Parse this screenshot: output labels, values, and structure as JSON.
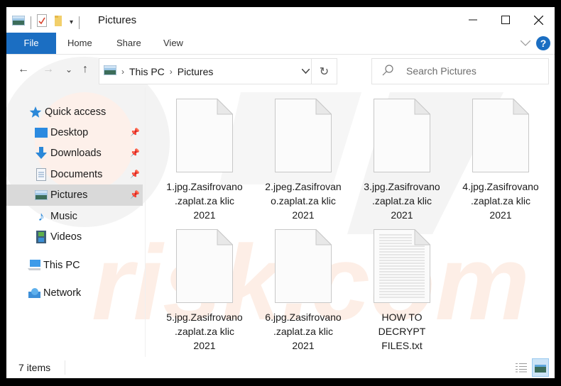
{
  "window": {
    "title": "Pictures",
    "controls": {
      "minimize": "minimize",
      "maximize": "maximize",
      "close": "close"
    }
  },
  "quick_access_toolbar": {
    "icons": [
      "pictures-folder-icon",
      "properties-icon",
      "new-folder-icon",
      "customize-dropdown-icon"
    ]
  },
  "ribbon": {
    "tabs": [
      {
        "label": "File",
        "active": true
      },
      {
        "label": "Home"
      },
      {
        "label": "Share"
      },
      {
        "label": "View"
      }
    ],
    "help_label": "?",
    "accent": "#1b6ec2"
  },
  "navigation": {
    "back": "←",
    "forward": "→",
    "recent": "⌄",
    "up": "↑",
    "breadcrumb": [
      "This PC",
      "Pictures"
    ],
    "refresh": "↻",
    "search_placeholder": "Search Pictures"
  },
  "sidebar": {
    "items": [
      {
        "label": "Quick access",
        "icon": "star-icon",
        "pinned": false,
        "selected": false
      },
      {
        "label": "Desktop",
        "icon": "desktop-icon",
        "pinned": true,
        "selected": false
      },
      {
        "label": "Downloads",
        "icon": "download-icon",
        "pinned": true,
        "selected": false
      },
      {
        "label": "Documents",
        "icon": "documents-icon",
        "pinned": true,
        "selected": false
      },
      {
        "label": "Pictures",
        "icon": "pictures-icon",
        "pinned": true,
        "selected": true
      },
      {
        "label": "Music",
        "icon": "music-icon",
        "pinned": false,
        "selected": false
      },
      {
        "label": "Videos",
        "icon": "videos-icon",
        "pinned": false,
        "selected": false
      },
      {
        "label": "This PC",
        "icon": "computer-icon",
        "pinned": false,
        "selected": false
      },
      {
        "label": "Network",
        "icon": "network-icon",
        "pinned": false,
        "selected": false
      }
    ]
  },
  "files": [
    {
      "name": "1.jpg.Zasifrovano.zaplat.za klic 2021",
      "lines": [
        "1.jpg.Zasifrovano",
        ".zaplat.za klic",
        "2021"
      ],
      "type": "blank"
    },
    {
      "name": "2.jpeg.Zasifrovano.zaplat.za klic 2021",
      "lines": [
        "2.jpeg.Zasifrovan",
        "o.zaplat.za klic",
        "2021"
      ],
      "type": "blank"
    },
    {
      "name": "3.jpg.Zasifrovano.zaplat.za klic 2021",
      "lines": [
        "3.jpg.Zasifrovano",
        ".zaplat.za klic",
        "2021"
      ],
      "type": "blank"
    },
    {
      "name": "4.jpg.Zasifrovano.zaplat.za klic 2021",
      "lines": [
        "4.jpg.Zasifrovano",
        ".zaplat.za klic",
        "2021"
      ],
      "type": "blank"
    },
    {
      "name": "5.jpg.Zasifrovano.zaplat.za klic 2021",
      "lines": [
        "5.jpg.Zasifrovano",
        ".zaplat.za klic",
        "2021"
      ],
      "type": "blank"
    },
    {
      "name": "6.jpg.Zasifrovano.zaplat.za klic 2021",
      "lines": [
        "6.jpg.Zasifrovano",
        ".zaplat.za klic",
        "2021"
      ],
      "type": "blank"
    },
    {
      "name": "HOW TO DECRYPT FILES.txt",
      "lines": [
        "HOW TO",
        "DECRYPT",
        "FILES.txt"
      ],
      "type": "text"
    }
  ],
  "status": {
    "item_count": "7 items",
    "views": [
      "details-view",
      "large-icons-view"
    ],
    "active_view": "large-icons-view"
  }
}
